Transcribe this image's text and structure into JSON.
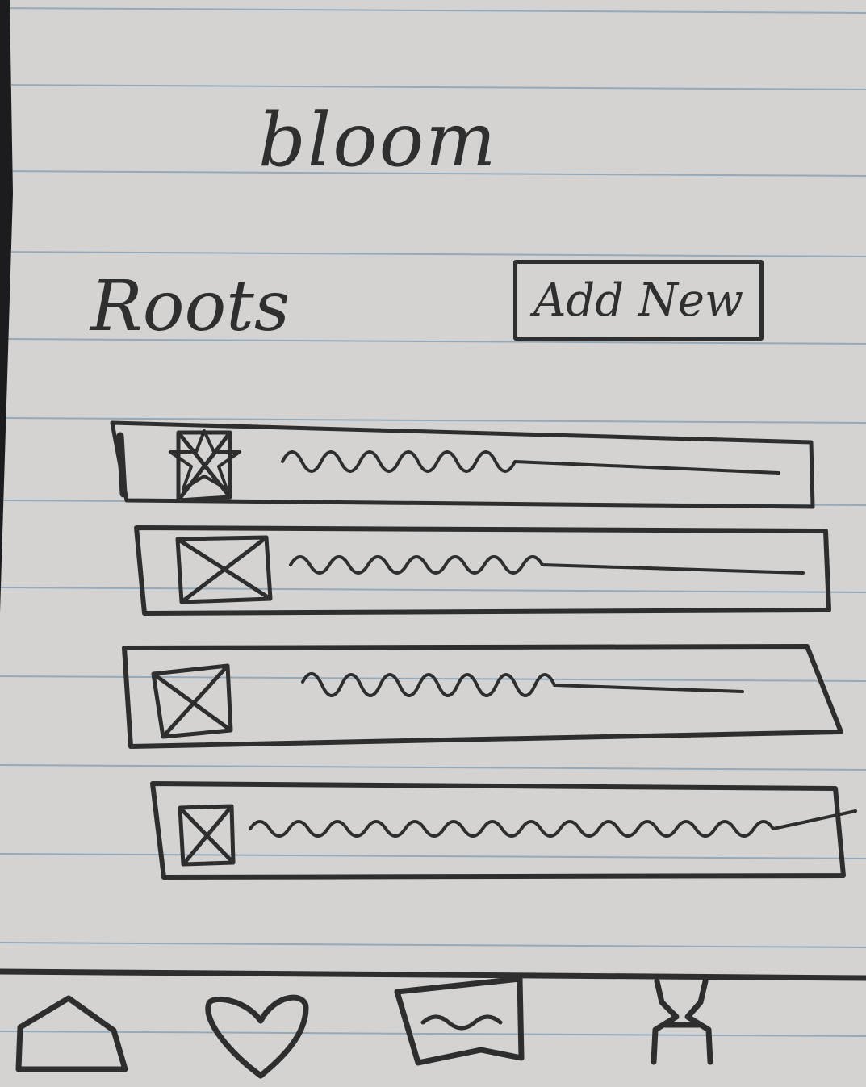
{
  "app": {
    "title": "bloom"
  },
  "header": {
    "section_title": "Roots",
    "add_button_label": "Add New"
  },
  "list": {
    "items": [
      {
        "thumbnail": "image-placeholder-icon",
        "text": ""
      },
      {
        "thumbnail": "image-placeholder-icon",
        "text": ""
      },
      {
        "thumbnail": "image-placeholder-icon",
        "text": ""
      },
      {
        "thumbnail": "image-placeholder-icon",
        "text": ""
      }
    ]
  },
  "bottom_nav": {
    "items": [
      {
        "icon": "home-icon"
      },
      {
        "icon": "heart-icon"
      },
      {
        "icon": "message-icon"
      },
      {
        "icon": "profile-icon"
      }
    ]
  },
  "colors": {
    "paper": "#d4d3d1",
    "ink": "#2f2f2f",
    "rule": "#7f9bb3"
  }
}
